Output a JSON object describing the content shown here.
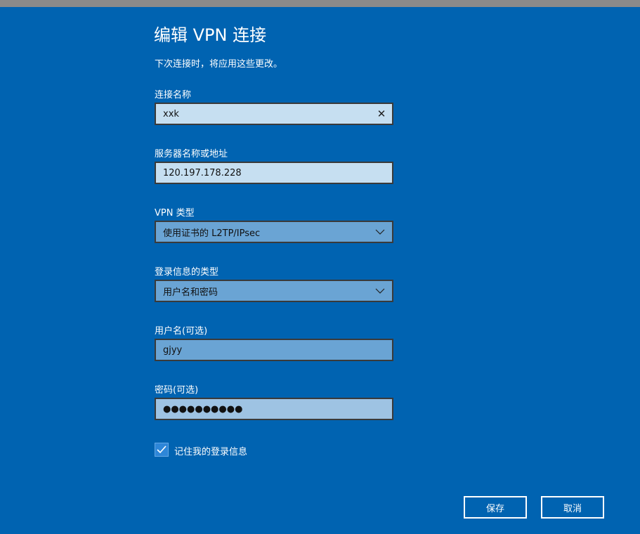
{
  "dialog": {
    "title": "编辑 VPN 连接",
    "subtitle": "下次连接时，将应用这些更改。"
  },
  "fields": {
    "connection_name": {
      "label": "连接名称",
      "value": "xxk"
    },
    "server": {
      "label": "服务器名称或地址",
      "value": "120.197.178.228"
    },
    "vpn_type": {
      "label": "VPN 类型",
      "value": "使用证书的 L2TP/IPsec"
    },
    "signin_type": {
      "label": "登录信息的类型",
      "value": "用户名和密码"
    },
    "username": {
      "label": "用户名(可选)",
      "value": "gjyy"
    },
    "password": {
      "label": "密码(可选)",
      "value": "●●●●●●●●●●"
    }
  },
  "remember": {
    "label": "记住我的登录信息",
    "checked": true
  },
  "buttons": {
    "save": "保存",
    "cancel": "取消"
  },
  "colors": {
    "background": "#0063b1",
    "accent": "#2d86d8"
  },
  "icons": {
    "clear": "close-icon",
    "dropdown": "chevron-down-icon",
    "check": "checkmark-icon"
  }
}
